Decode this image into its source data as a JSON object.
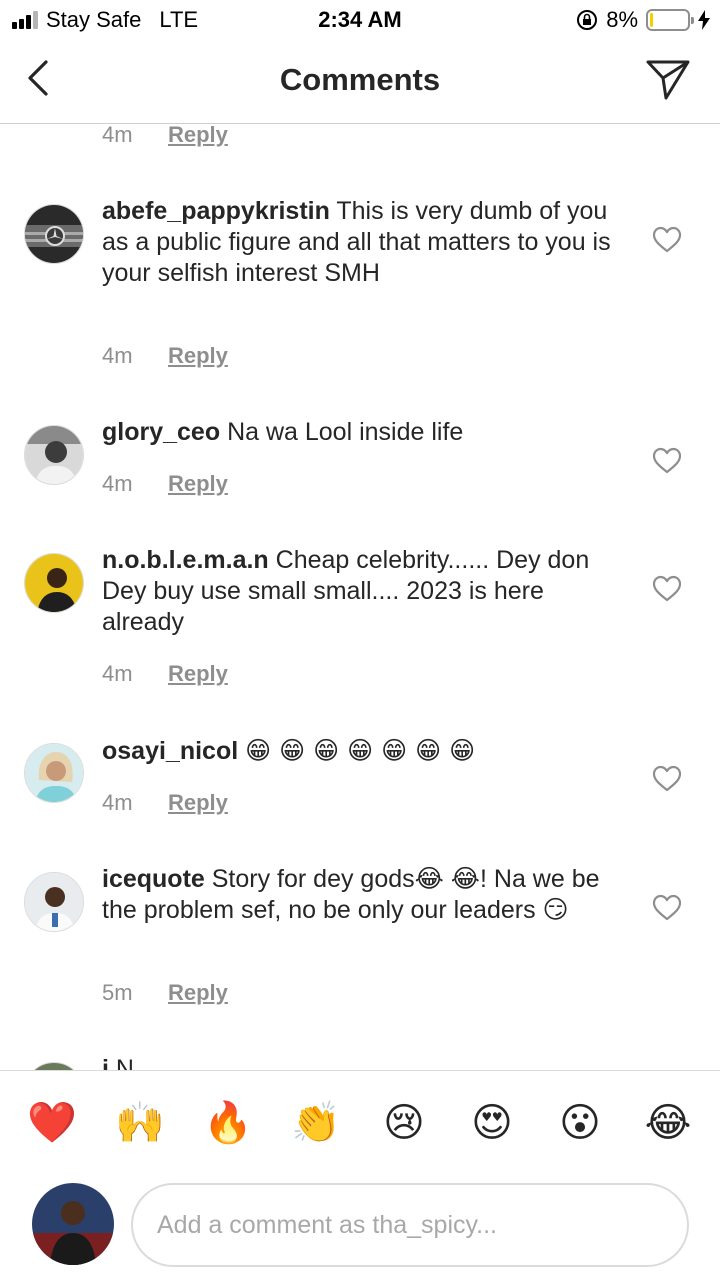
{
  "status_bar": {
    "carrier": "Stay Safe",
    "network": "LTE",
    "time": "2:34 AM",
    "battery_percent_text": "8%",
    "battery_level": 0.08
  },
  "header": {
    "title": "Comments"
  },
  "top_partial": {
    "time": "4m",
    "reply": "Reply"
  },
  "comments": [
    {
      "username": "abefe_pappykristin",
      "text": "This is very dumb of you as a public figure and all that matters to you is your selfish interest SMH",
      "time": "4m",
      "reply": "Reply"
    },
    {
      "username": "glory_ceo",
      "text": "Na wa Lool inside life",
      "time": "4m",
      "reply": "Reply"
    },
    {
      "username": "n.o.b.l.e.m.a.n",
      "text": "Cheap celebrity...... Dey don Dey buy use small small.... 2023 is here already",
      "time": "4m",
      "reply": "Reply"
    },
    {
      "username": "osayi_nicol",
      "text": "😁 😁 😁 😁 😁 😁 😁",
      "time": "4m",
      "reply": "Reply"
    },
    {
      "username": "icequote",
      "text": "Story for dey gods😂 😂! Na we be the problem sef, no be only our leaders 😏",
      "time": "5m",
      "reply": "Reply"
    }
  ],
  "partial_comment": {
    "username": "i",
    "text": "N"
  },
  "emoji_bar": [
    "❤️",
    "🙌",
    "🔥",
    "👏",
    "😢",
    "😍",
    "😮",
    "😂"
  ],
  "composer": {
    "placeholder": "Add a comment as tha_spicy..."
  },
  "colors": {
    "battery": "#f5d000",
    "text": "#262626",
    "muted": "#8e8e8e"
  },
  "icons": [
    "signal-bars-icon",
    "orientation-lock-icon",
    "battery-icon",
    "charging-bolt-icon",
    "back-chevron-icon",
    "direct-send-icon",
    "heart-outline-icon"
  ]
}
